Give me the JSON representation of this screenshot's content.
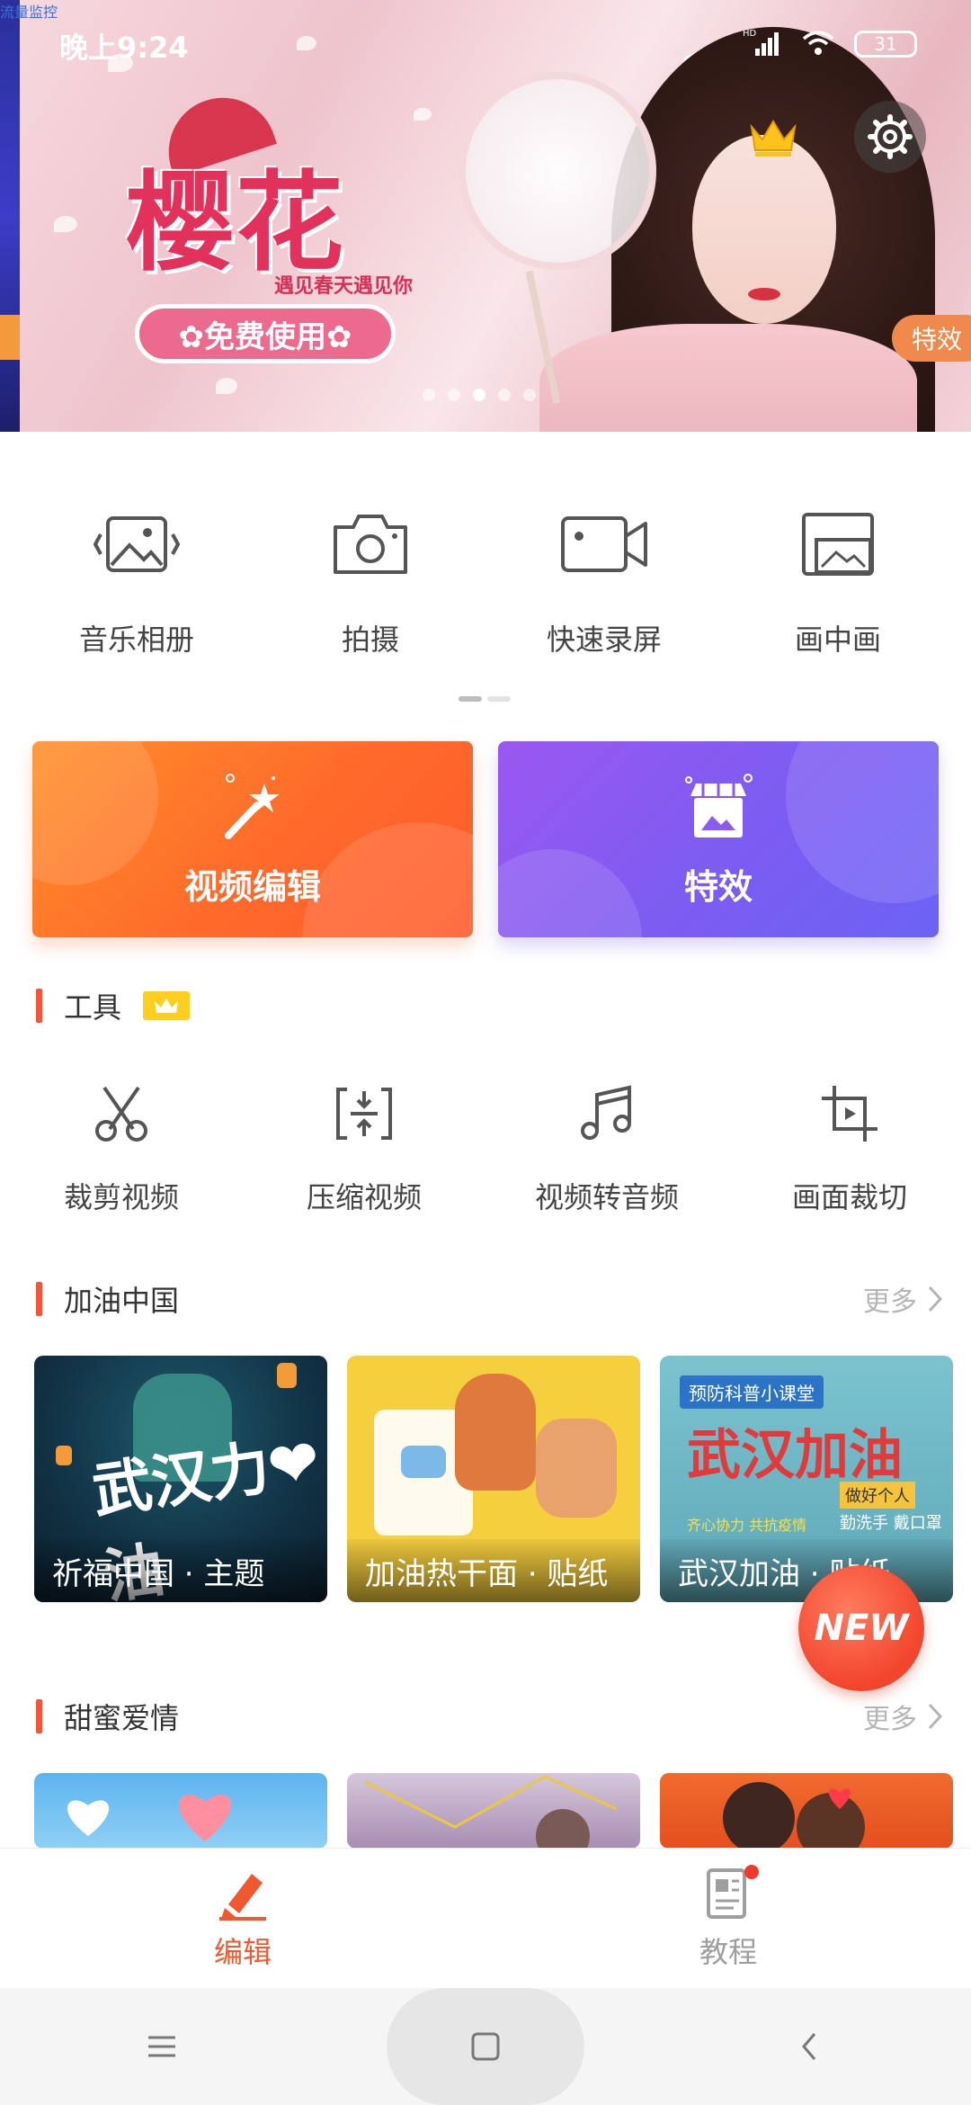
{
  "corner_label": "流量监控",
  "status": {
    "time": "晚上9:24",
    "network": "HD",
    "battery": "31"
  },
  "banner": {
    "title": "樱花",
    "subtitle": "遇见春天遇见你",
    "cta": "✿免费使用✿",
    "side_tag": "特效",
    "slides": 5,
    "active_slide": 3
  },
  "quick_actions": [
    {
      "label": "音乐相册",
      "icon": "photo-album-icon"
    },
    {
      "label": "拍摄",
      "icon": "camera-icon"
    },
    {
      "label": "快速录屏",
      "icon": "screen-record-icon"
    },
    {
      "label": "画中画",
      "icon": "picture-in-picture-icon"
    }
  ],
  "feature_cards": [
    {
      "label": "视频编辑",
      "icon": "magic-wand-icon",
      "color": "#ff6a2b"
    },
    {
      "label": "特效",
      "icon": "effects-shop-icon",
      "color": "#7c5cf2"
    }
  ],
  "tools_section": {
    "title": "工具",
    "tools": [
      {
        "label": "裁剪视频",
        "icon": "scissors-icon"
      },
      {
        "label": "压缩视频",
        "icon": "compress-icon"
      },
      {
        "label": "视频转音频",
        "icon": "music-note-icon"
      },
      {
        "label": "画面裁切",
        "icon": "crop-icon"
      }
    ]
  },
  "section_china": {
    "title": "加油中国",
    "more": "更多",
    "items": [
      {
        "caption": "祈福中国 · 主题",
        "art_text": "武汉力❤油"
      },
      {
        "caption": "加油热干面 · 贴纸",
        "art_text": ""
      },
      {
        "caption": "武汉加油 · 贴纸",
        "art_text": "武汉加油",
        "tag": "预防科普小课堂",
        "note1": "做好个人",
        "note2": "勤洗手 戴口罩",
        "note3": "齐心协力 共抗疫情"
      }
    ]
  },
  "section_love": {
    "title": "甜蜜爱情",
    "more": "更多"
  },
  "new_badge": "NEW",
  "tabs": [
    {
      "label": "编辑",
      "active": true
    },
    {
      "label": "教程",
      "active": false
    }
  ],
  "colors": {
    "accent": "#f0592f",
    "section_bar": "#f4533c",
    "vip": "#ffcf1f"
  }
}
